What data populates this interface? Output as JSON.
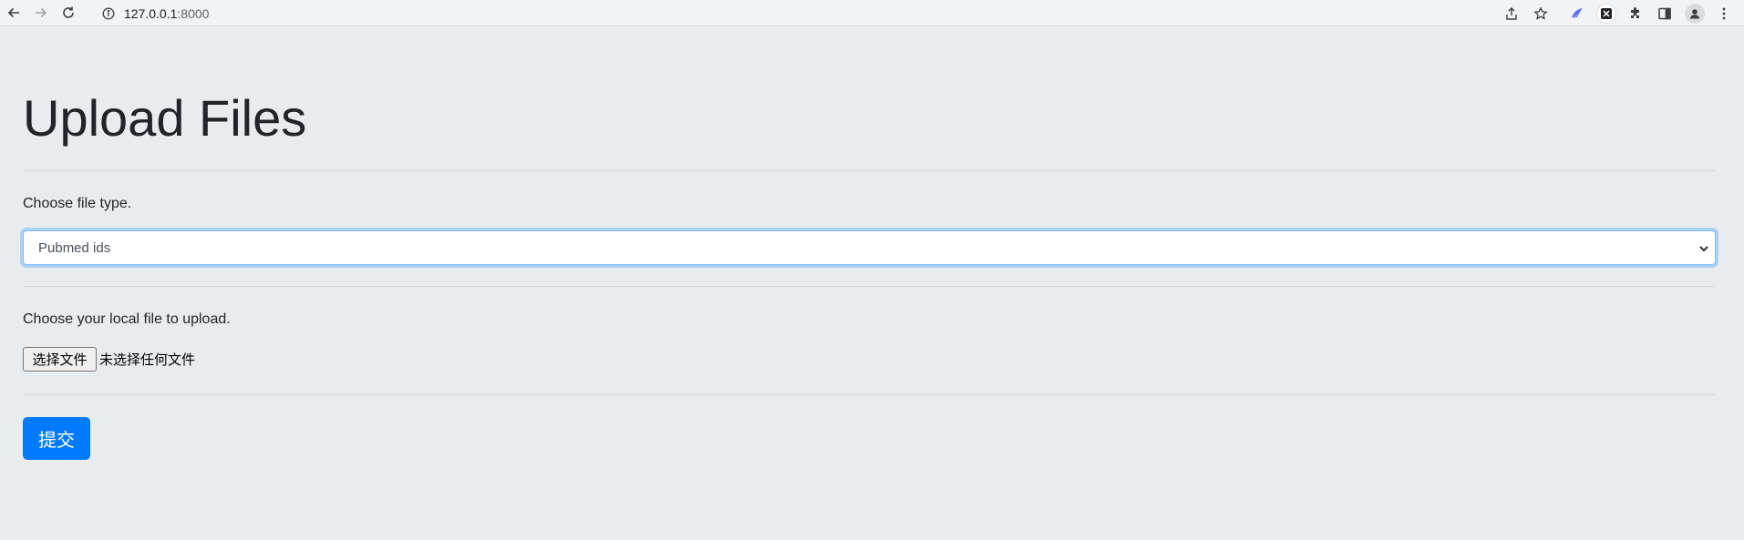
{
  "browser": {
    "url_host": "127.0.0.1",
    "url_port": ":8000",
    "icons": [
      "back-icon",
      "forward-icon",
      "reload-icon",
      "info-icon",
      "share-icon",
      "star-icon",
      "extension-bird-icon",
      "extension-x-icon",
      "puzzle-icon",
      "sidebar-icon",
      "profile-icon",
      "menu-icon"
    ]
  },
  "page": {
    "title": "Upload Files",
    "file_type_label": "Choose file type.",
    "file_type_selected": "Pubmed ids",
    "local_file_label": "Choose your local file to upload.",
    "choose_file_button": "选择文件",
    "no_file_chosen": "未选择任何文件",
    "submit_button": "提交"
  },
  "colors": {
    "background": "#e9ecef",
    "primary": "#007bff",
    "focus_border": "#80bdff"
  }
}
